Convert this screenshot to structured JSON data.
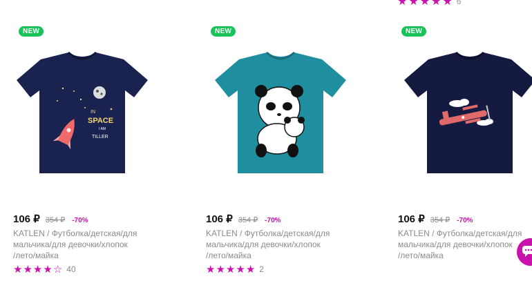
{
  "top_rating": {
    "stars": 5,
    "count": "6"
  },
  "products": [
    {
      "badge": "NEW",
      "price": "106 ₽",
      "old_price": "354 ₽",
      "discount": "-70%",
      "title": "KATLEN / Футболка/детская/для\nмальчика/для девочки/хлопок\n/лето/майка",
      "rating": 4,
      "reviews": "40",
      "shirt_color": "#1a2350",
      "print": "space-rocket"
    },
    {
      "badge": "NEW",
      "price": "106 ₽",
      "old_price": "354 ₽",
      "discount": "-70%",
      "title": "KATLEN / Футболка/детская/для\nмальчика/для девочки/хлопок\n/лето/майка",
      "rating": 5,
      "reviews": "2",
      "shirt_color": "#1f8f9f",
      "print": "panda"
    },
    {
      "badge": "NEW",
      "price": "106 ₽",
      "old_price": "354 ₽",
      "discount": "-70%",
      "title": "KATLEN / Футболка/детская/для\nмальчика/для девочки/хлопок\n/лето/майка",
      "rating": null,
      "reviews": null,
      "shirt_color": "#141a40",
      "print": "airplane"
    }
  ],
  "colors": {
    "accent": "#cb11ab",
    "badge_green": "#18c45a"
  },
  "chat_button_icon": "chat-bubble-icon"
}
